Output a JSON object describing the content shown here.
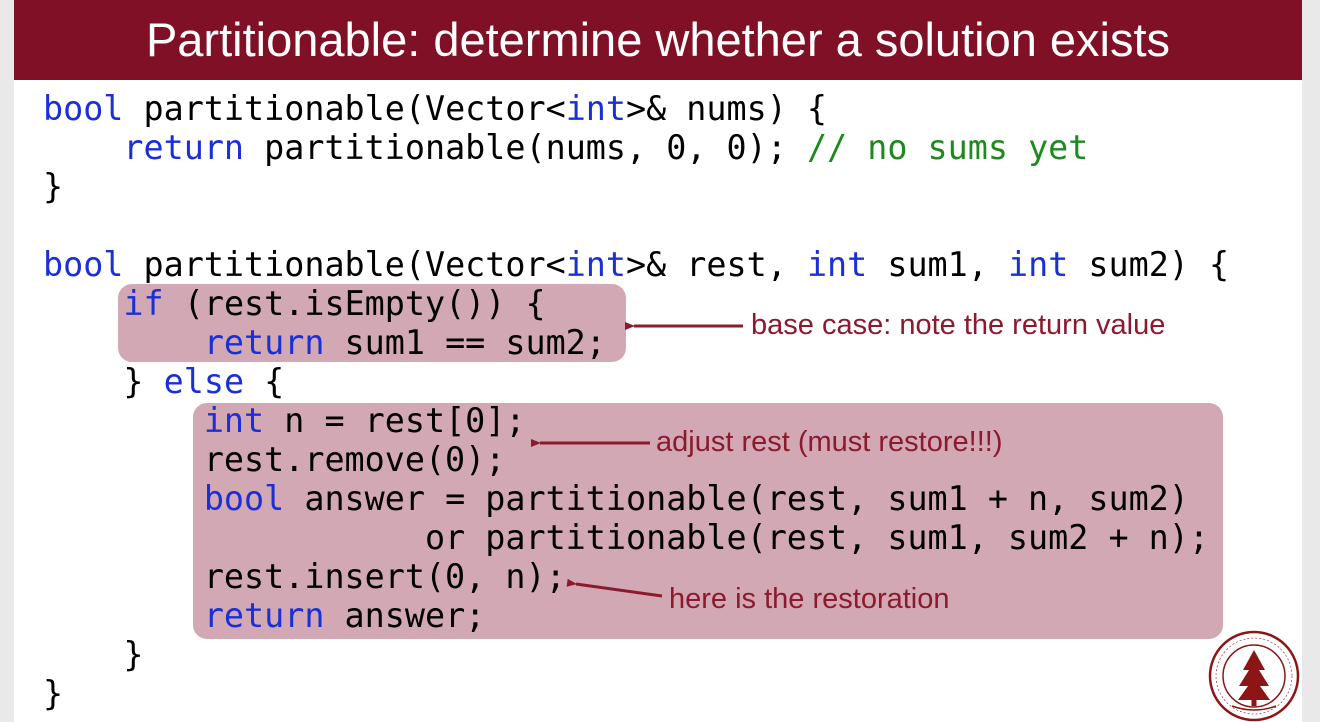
{
  "slide": {
    "title": "Partitionable: determine whether a solution exists"
  },
  "code": {
    "l1": {
      "kw": "bool",
      "text": " partitionable(Vector<",
      "kw2": "int",
      "text2": ">& nums) {"
    },
    "l2": {
      "indent": "    ",
      "kw": "return",
      "text": " partitionable(nums, 0, 0); ",
      "comment": "// no sums yet"
    },
    "l3": {
      "text": "}"
    },
    "l4": {
      "text": ""
    },
    "l5": {
      "kw": "bool",
      "text": " partitionable(Vector<",
      "kw2": "int",
      "text2": ">& rest, ",
      "kw3": "int",
      "text3": " sum1, ",
      "kw4": "int",
      "text4": " sum2) {"
    },
    "l6": {
      "indent": "    ",
      "kw": "if",
      "text": " (rest.isEmpty()) {"
    },
    "l7": {
      "indent": "        ",
      "kw": "return",
      "text": " sum1 == sum2;"
    },
    "l8": {
      "indent": "    ",
      "text": "} ",
      "kw": "else",
      "text2": " {"
    },
    "l9": {
      "indent": "        ",
      "kw": "int",
      "text": " n = rest[0];"
    },
    "l10": {
      "indent": "        ",
      "text": "rest.remove(0);"
    },
    "l11": {
      "indent": "        ",
      "kw": "bool",
      "text": " answer = partitionable(rest, sum1 + n, sum2)"
    },
    "l12": {
      "text": "                   or partitionable(rest, sum1, sum2 + n);"
    },
    "l13": {
      "indent": "        ",
      "text": "rest.insert(0, n);"
    },
    "l14": {
      "indent": "        ",
      "kw": "return",
      "text": " answer;"
    },
    "l15": {
      "text": "    }"
    },
    "l16": {
      "text": "}"
    }
  },
  "annotations": {
    "base_case": "base case: note the return value",
    "adjust_rest": "adjust rest (must restore!!!)",
    "restoration": "here is the restoration"
  },
  "colors": {
    "title_bar": "#7f1026",
    "keyword": "#1b2fd6",
    "comment": "#1c8a1c",
    "highlight": "#d1a8b3",
    "annotation": "#8b1a2e"
  },
  "icons": {
    "seal": "stanford-seal-icon"
  }
}
